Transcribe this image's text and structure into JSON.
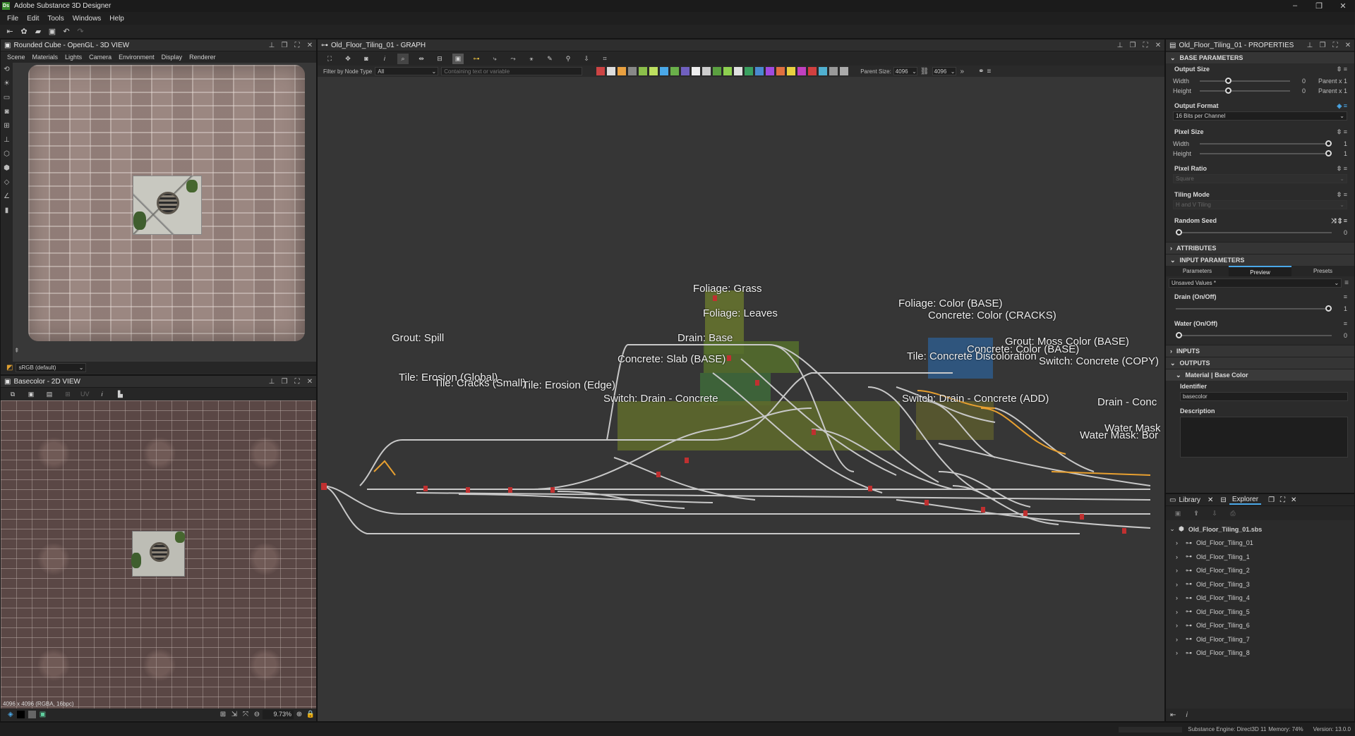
{
  "app": {
    "title": "Adobe Substance 3D Designer",
    "logo": "Ds"
  },
  "window_controls": [
    "–",
    "❐",
    "✕"
  ],
  "menu": [
    "File",
    "Edit",
    "Tools",
    "Windows",
    "Help"
  ],
  "view3d": {
    "title": "Rounded Cube - OpenGL - 3D VIEW",
    "menu": [
      "Scene",
      "Materials",
      "Lights",
      "Camera",
      "Environment",
      "Display",
      "Renderer"
    ],
    "colorspace": "sRGB (default)"
  },
  "view2d": {
    "title": "Basecolor - 2D VIEW",
    "uv_label": "UV",
    "info": "4096 x 4096 (RGBA, 16bpc)",
    "zoom": "9.73%"
  },
  "graph": {
    "title": "Old_Floor_Tiling_01 - GRAPH",
    "filter_label": "Filter by Node Type",
    "filter_value": "All",
    "search_placeholder": "Containing text or variable",
    "parent_size_label": "Parent Size:",
    "parent_size_value": "4096",
    "size_value": "4096",
    "frames": [
      "Foliage: Grass",
      "Foliage: Leaves",
      "Foliage: Color (BASE)",
      "Concrete: Color (CRACKS)",
      "Grout: Spill",
      "Drain: Base",
      "Grout: Moss Color (BASE)",
      "Concrete: Color (BASE)",
      "Tile: Concrete Discoloration",
      "Switch: Concrete (COPY)",
      "Concrete: Slab (BASE)",
      "Tile: Erosion (Global)",
      "Tile: Cracks (Small)",
      "Tile: Erosion (Edge)",
      "Switch: Drain - Concrete (ADD)",
      "Switch: Drain - Concrete",
      "Drain - Conc",
      "Water Mask",
      "Water Mask: Bor"
    ]
  },
  "properties": {
    "title": "Old_Floor_Tiling_01 - PROPERTIES",
    "base_parameters": "BASE PARAMETERS",
    "output_size": {
      "label": "Output Size",
      "width_label": "Width",
      "height_label": "Height",
      "width_value": "0",
      "height_value": "0",
      "width_mode": "Parent x 1",
      "height_mode": "Parent x 1"
    },
    "output_format": {
      "label": "Output Format",
      "value": "16 Bits per Channel"
    },
    "pixel_size": {
      "label": "Pixel Size",
      "width_label": "Width",
      "height_label": "Height",
      "width_value": "1",
      "height_value": "1"
    },
    "pixel_ratio": {
      "label": "Pixel Ratio",
      "value": "Square"
    },
    "tiling_mode": {
      "label": "Tiling Mode",
      "value": "H and V Tiling"
    },
    "random_seed": {
      "label": "Random Seed",
      "value": "0"
    },
    "attributes": "ATTRIBUTES",
    "input_parameters": "INPUT PARAMETERS",
    "tabs": [
      "Parameters",
      "Preview",
      "Presets"
    ],
    "preset_value": "Unsaved Values *",
    "drain": {
      "label": "Drain (On/Off)",
      "value": "1",
      "level": 1
    },
    "water": {
      "label": "Water (On/Off)",
      "value": "0",
      "level": 0
    },
    "inputs": "INPUTS",
    "outputs": "OUTPUTS",
    "output_item": "Material | Base Color",
    "identifier_label": "Identifier",
    "identifier_value": "basecolor",
    "description_label": "Description"
  },
  "explorer": {
    "tabs": [
      "Library",
      "Explorer"
    ],
    "root": "Old_Floor_Tiling_01.sbs",
    "items": [
      "Old_Floor_Tiling_01",
      "Old_Floor_Tiling_1",
      "Old_Floor_Tiling_2",
      "Old_Floor_Tiling_3",
      "Old_Floor_Tiling_4",
      "Old_Floor_Tiling_5",
      "Old_Floor_Tiling_6",
      "Old_Floor_Tiling_7",
      "Old_Floor_Tiling_8"
    ]
  },
  "status": {
    "engine": "Substance Engine: Direct3D 11",
    "memory": "Memory: 74%",
    "version": "Version: 13.0.0"
  }
}
